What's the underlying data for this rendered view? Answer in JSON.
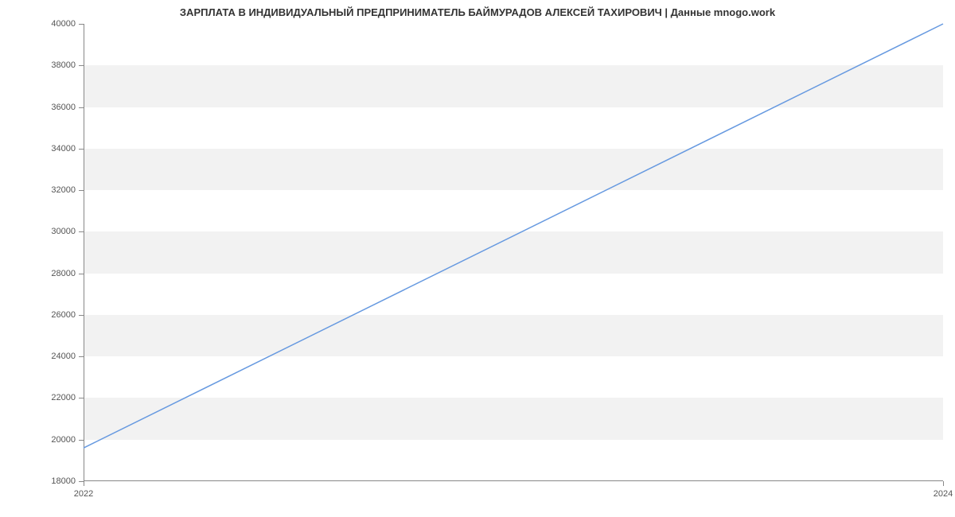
{
  "chart_data": {
    "type": "line",
    "title": "ЗАРПЛАТА В ИНДИВИДУАЛЬНЫЙ ПРЕДПРИНИМАТЕЛЬ БАЙМУРАДОВ АЛЕКСЕЙ ТАХИРОВИЧ | Данные mnogo.work",
    "x": [
      2022,
      2024
    ],
    "values": [
      19600,
      40000
    ],
    "xlabel": "",
    "ylabel": "",
    "xlim": [
      2022,
      2024
    ],
    "ylim": [
      18000,
      40000
    ],
    "x_ticks": [
      2022,
      2024
    ],
    "y_ticks": [
      18000,
      20000,
      22000,
      24000,
      26000,
      28000,
      30000,
      32000,
      34000,
      36000,
      38000,
      40000
    ],
    "line_color": "#6699e0",
    "band_color": "#f2f2f2"
  }
}
